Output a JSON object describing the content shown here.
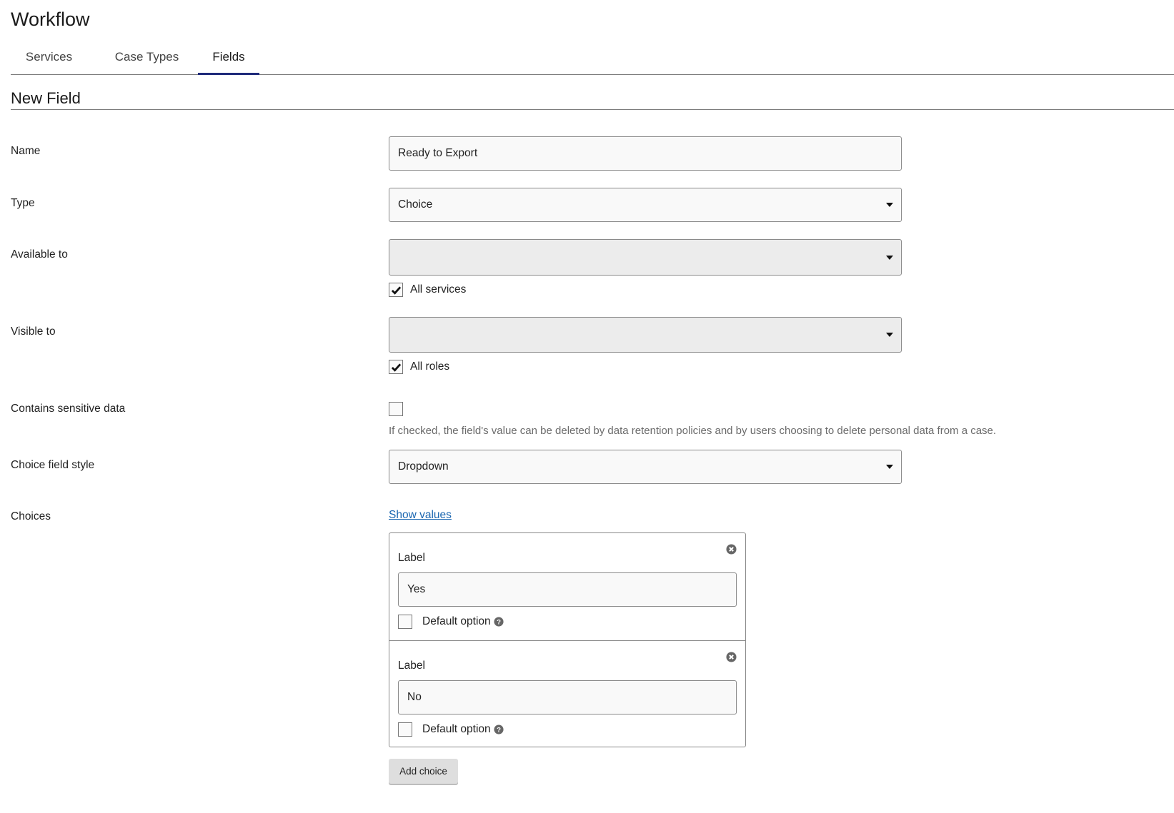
{
  "header": {
    "title": "Workflow"
  },
  "tabs": [
    {
      "label": "Services",
      "active": false
    },
    {
      "label": "Case Types",
      "active": false
    },
    {
      "label": "Fields",
      "active": true
    }
  ],
  "form": {
    "title": "New Field",
    "name": {
      "label": "Name",
      "value": "Ready to Export"
    },
    "type": {
      "label": "Type",
      "value": "Choice"
    },
    "available_to": {
      "label": "Available to",
      "value": "",
      "all_checkbox_label": "All services",
      "all_checked": true
    },
    "visible_to": {
      "label": "Visible to",
      "value": "",
      "all_checkbox_label": "All roles",
      "all_checked": true
    },
    "sensitive": {
      "label": "Contains sensitive data",
      "checked": false,
      "hint": "If checked, the field's value can be deleted by data retention policies and by users choosing to delete personal data from a case."
    },
    "choice_style": {
      "label": "Choice field style",
      "value": "Dropdown"
    },
    "choices": {
      "label": "Choices",
      "show_values_link": "Show values",
      "items": [
        {
          "label_caption": "Label",
          "value": "Yes",
          "default_label": "Default option",
          "default_checked": false
        },
        {
          "label_caption": "Label",
          "value": "No",
          "default_label": "Default option",
          "default_checked": false
        }
      ],
      "add_button": "Add choice"
    }
  },
  "icons": {
    "dropdown": "caret-down-icon",
    "checkmark": "checkmark-icon",
    "remove": "circle-x-icon",
    "help": "question-circle-icon"
  },
  "colors": {
    "active_tab_underline": "#1f2a7a",
    "link": "#1a66b0",
    "hint_text": "#6b6b6b",
    "disabled_select": "#ececec"
  }
}
